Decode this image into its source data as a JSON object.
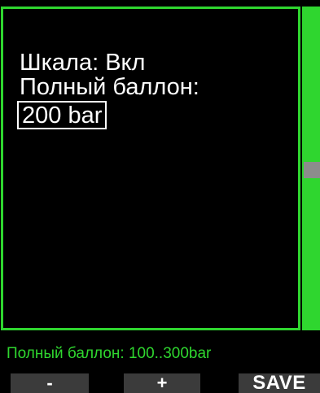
{
  "settings": {
    "scale_line": "Шкала: Вкл",
    "full_tank_label": "Полный баллон:",
    "full_tank_value": "200 bar"
  },
  "info": {
    "range_text": "Полный баллон: 100..300bar"
  },
  "softkeys": {
    "minus": "-",
    "plus": "+",
    "save": "SAVE"
  },
  "colors": {
    "accent": "#2fd62f",
    "background": "#000000",
    "text": "#ffffff",
    "softkey_bg": "#3b3b3b",
    "scroll_thumb": "#8c8c8c"
  }
}
